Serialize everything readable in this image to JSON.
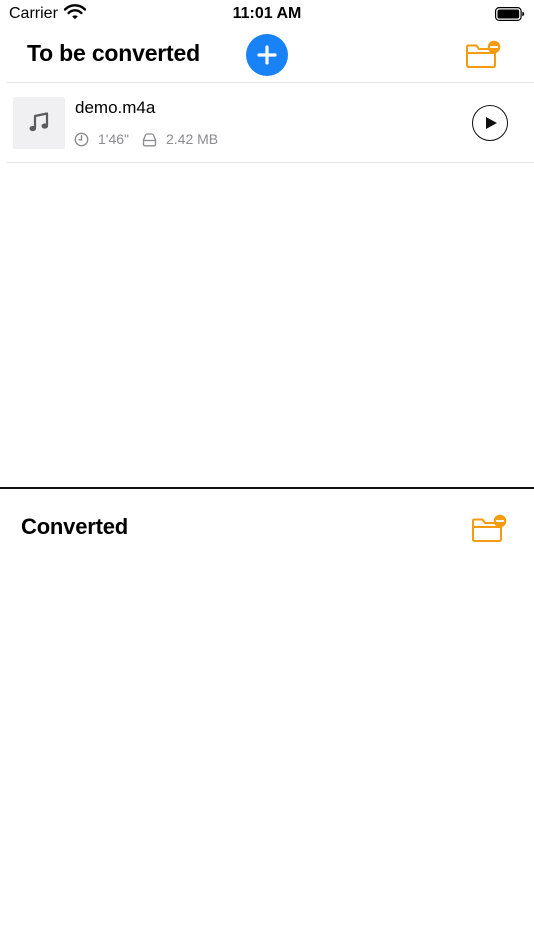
{
  "status_bar": {
    "carrier": "Carrier",
    "time": "11:01 AM",
    "wifi_icon": "wifi-icon",
    "battery_icon": "battery-icon"
  },
  "to_be_converted": {
    "title": "To be converted",
    "add_icon": "plus-icon",
    "folder_icon": "folder-remove-icon",
    "files": [
      {
        "name": "demo.m4a",
        "thumbnail_icon": "music-note-icon",
        "duration": "1'46\"",
        "size": "2.42 MB",
        "play_icon": "play-icon"
      }
    ]
  },
  "converted": {
    "title": "Converted",
    "folder_icon": "folder-remove-icon"
  },
  "colors": {
    "accent_blue": "#1a82f7",
    "folder_orange": "#f59b0f",
    "meta_gray": "#8b8b90",
    "divider": "#e6e6e9"
  }
}
